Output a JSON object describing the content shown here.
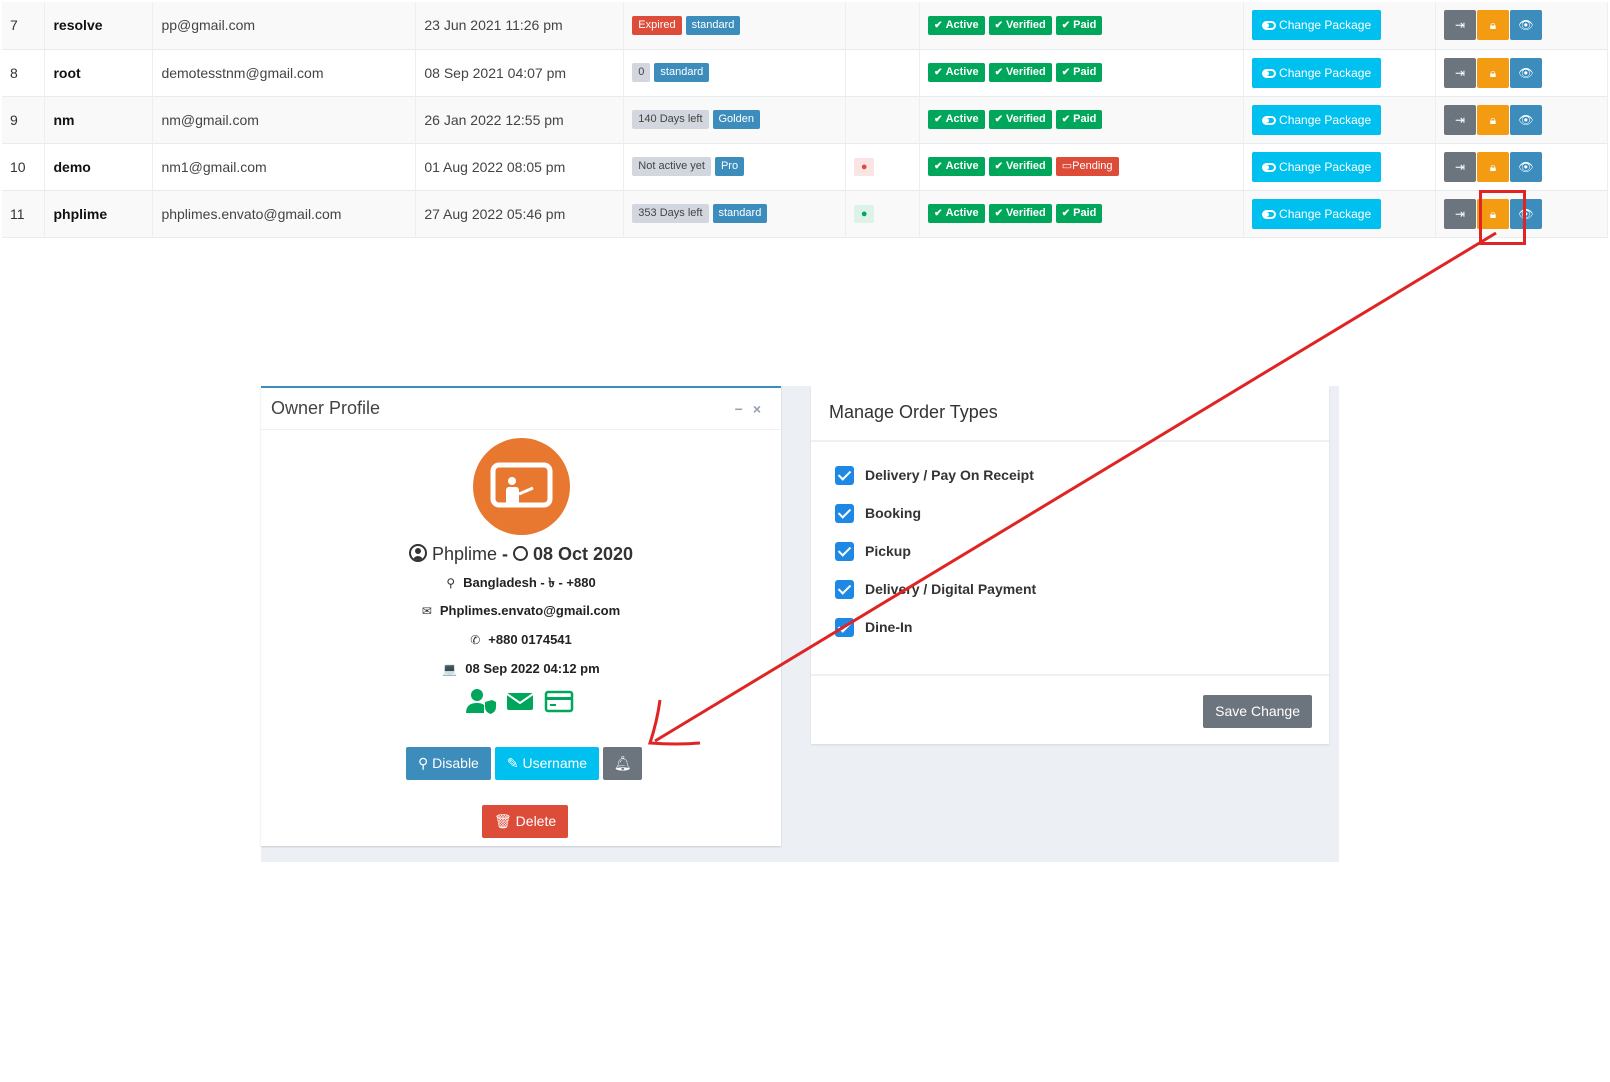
{
  "users": [
    {
      "id": "7",
      "name": "resolve",
      "email": "pp@gmail.com",
      "date": "23 Jun 2021 11:26 pm",
      "pkg_status": "Expired",
      "pkg_status_style": "red",
      "pkg_name": "standard",
      "bell": "",
      "flags": [
        "Active",
        "Verified",
        "Paid"
      ],
      "flag_styles": [
        "green",
        "green",
        "green"
      ]
    },
    {
      "id": "8",
      "name": "root",
      "email": "demotesstnm@gmail.com",
      "date": "08 Sep 2021 04:07 pm",
      "pkg_status": "0",
      "pkg_status_style": "grey",
      "pkg_name": "standard",
      "bell": "",
      "flags": [
        "Active",
        "Verified",
        "Paid"
      ],
      "flag_styles": [
        "green",
        "green",
        "green"
      ]
    },
    {
      "id": "9",
      "name": "nm",
      "email": "nm@gmail.com",
      "date": "26 Jan 2022 12:55 pm",
      "pkg_status": "140 Days left",
      "pkg_status_style": "grey",
      "pkg_name": "Golden",
      "bell": "",
      "flags": [
        "Active",
        "Verified",
        "Paid"
      ],
      "flag_styles": [
        "green",
        "green",
        "green"
      ]
    },
    {
      "id": "10",
      "name": "demo",
      "email": "nm1@gmail.com",
      "date": "01 Aug 2022 08:05 pm",
      "pkg_status": "Not active yet",
      "pkg_status_style": "grey",
      "pkg_name": "Pro",
      "bell": "red",
      "flags": [
        "Active",
        "Verified",
        "Pending"
      ],
      "flag_styles": [
        "green",
        "green",
        "red"
      ]
    },
    {
      "id": "11",
      "name": "phplime",
      "email": "phplimes.envato@gmail.com",
      "date": "27 Aug 2022 05:46 pm",
      "pkg_status": "353 Days left",
      "pkg_status_style": "grey",
      "pkg_name": "standard",
      "bell": "green",
      "flags": [
        "Active",
        "Verified",
        "Paid"
      ],
      "flag_styles": [
        "green",
        "green",
        "green"
      ]
    }
  ],
  "change_package_label": "Change Package",
  "colors": {
    "primary": "#3c8dbc",
    "info": "#00c0ef",
    "success": "#00a65a",
    "danger": "#dd4b39",
    "warning": "#f39c12",
    "secondary": "#6c757d",
    "annotation": "#e02424",
    "avatar": "#e8782f"
  },
  "profile": {
    "title": "Owner Profile",
    "name": "Phplime",
    "joined": "08 Oct 2020",
    "location": "Bangladesh - ৳ - +880",
    "email": "Phplimes.envato@gmail.com",
    "phone": "+880 0174541",
    "last_login": "08 Sep 2022 04:12 pm",
    "disable_label": "Disable",
    "username_label": "Username",
    "delete_label": "Delete",
    "icons": [
      "user-shield-icon",
      "envelope-icon",
      "credit-card-icon"
    ]
  },
  "order_types": {
    "title": "Manage Order Types",
    "items": [
      "Delivery / Pay On Receipt",
      "Booking",
      "Pickup",
      "Delivery / Digital Payment",
      "Dine-In"
    ],
    "save_label": "Save Change"
  }
}
